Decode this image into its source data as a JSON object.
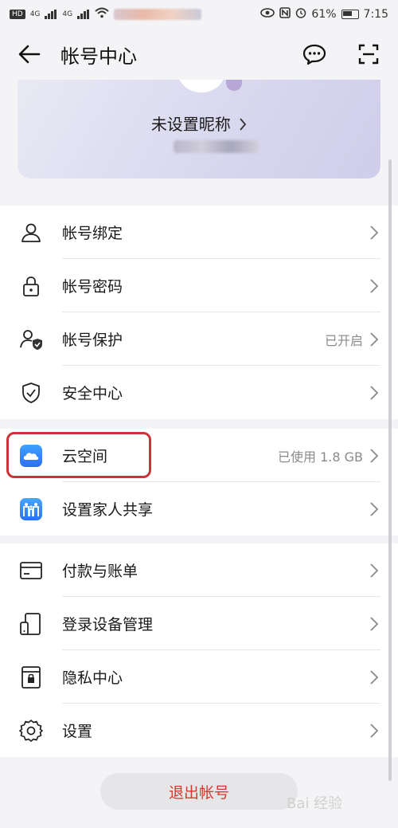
{
  "statusbar": {
    "hd": "HD",
    "net1": "4G",
    "net2": "4G",
    "battery": "61%",
    "time": "7:15",
    "icons": [
      "eye-icon",
      "nfc-icon",
      "alarm-icon",
      "battery-icon"
    ]
  },
  "header": {
    "title": "帐号中心",
    "icons": [
      "back-arrow-icon",
      "message-icon",
      "scan-icon"
    ]
  },
  "profile": {
    "nickname": "未设置昵称"
  },
  "group1": [
    {
      "label": "帐号绑定",
      "value": "",
      "icon": "user-icon"
    },
    {
      "label": "帐号密码",
      "value": "",
      "icon": "lock-icon"
    },
    {
      "label": "帐号保护",
      "value": "已开启",
      "icon": "user-shield-icon"
    },
    {
      "label": "安全中心",
      "value": "",
      "icon": "shield-check-icon"
    }
  ],
  "group2": [
    {
      "label": "云空间",
      "value": "已使用 1.8 GB",
      "icon": "cloud-icon"
    },
    {
      "label": "设置家人共享",
      "value": "",
      "icon": "family-icon"
    }
  ],
  "group3": [
    {
      "label": "付款与账单",
      "value": "",
      "icon": "card-icon"
    },
    {
      "label": "登录设备管理",
      "value": "",
      "icon": "devices-icon"
    },
    {
      "label": "隐私中心",
      "value": "",
      "icon": "privacy-icon"
    },
    {
      "label": "设置",
      "value": "",
      "icon": "gear-icon"
    }
  ],
  "logout": {
    "label": "退出帐号"
  },
  "watermark": "Bai 经验",
  "colors": {
    "accent_red": "#d23b2e",
    "highlight": "#c9343a",
    "cloud_blue": "#2f7cf6"
  }
}
